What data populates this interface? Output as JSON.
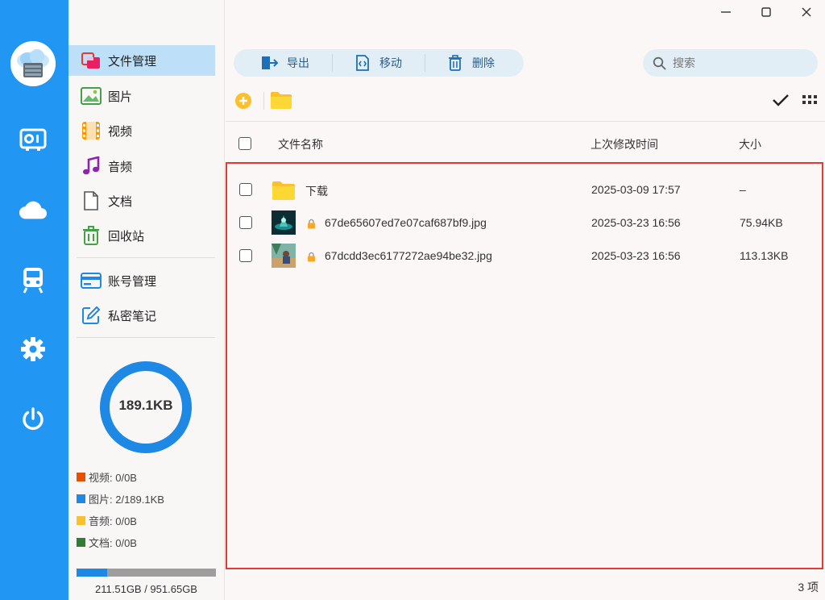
{
  "sidebar": {
    "items": [
      {
        "label": "文件管理",
        "icon": "folder-manage-icon"
      },
      {
        "label": "图片",
        "icon": "image-icon"
      },
      {
        "label": "视频",
        "icon": "film-icon"
      },
      {
        "label": "音频",
        "icon": "music-icon"
      },
      {
        "label": "文档",
        "icon": "document-icon"
      },
      {
        "label": "回收站",
        "icon": "trash-icon"
      },
      {
        "label": "账号管理",
        "icon": "card-icon"
      },
      {
        "label": "私密笔记",
        "icon": "edit-icon"
      }
    ],
    "storage": {
      "used_label": "189.1KB",
      "legend": [
        {
          "label": "视频: 0/0B",
          "color": "#e65100"
        },
        {
          "label": "图片: 2/189.1KB",
          "color": "#1e88e5"
        },
        {
          "label": "音频: 0/0B",
          "color": "#fbc02d"
        },
        {
          "label": "文档: 0/0B",
          "color": "#2e7d32"
        }
      ],
      "disk_label": "211.51GB / 951.65GB",
      "disk_used_fraction": 0.222
    }
  },
  "toolbar": {
    "export_label": "导出",
    "move_label": "移动",
    "delete_label": "删除",
    "search_placeholder": "搜索"
  },
  "table": {
    "headers": {
      "name": "文件名称",
      "modified": "上次修改时间",
      "size": "大小"
    },
    "rows": [
      {
        "type": "folder",
        "name": "下载",
        "modified": "2025-03-09 17:57",
        "size": "–",
        "locked": false
      },
      {
        "type": "image",
        "name": "67de65607ed7e07caf687bf9.jpg",
        "modified": "2025-03-23 16:56",
        "size": "75.94KB",
        "locked": true
      },
      {
        "type": "image",
        "name": "67dcdd3ec6177272ae94be32.jpg",
        "modified": "2025-03-23 16:56",
        "size": "113.13KB",
        "locked": true
      }
    ]
  },
  "footer": {
    "count_label": "3 项"
  },
  "colors": {
    "accent": "#2196f3",
    "active_bg": "#bde0f8",
    "highlight_border": "#e53935",
    "folder": "#fbc02d"
  }
}
